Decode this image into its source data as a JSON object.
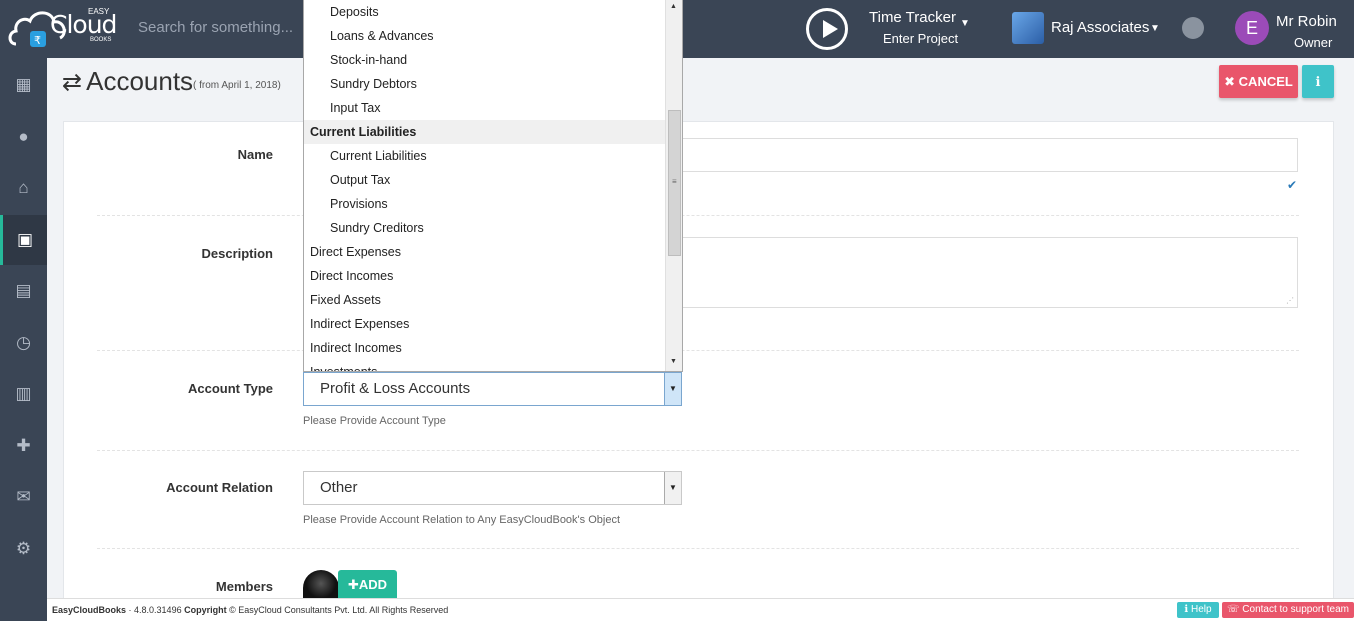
{
  "header": {
    "logo": {
      "easy": "EASY",
      "cloud": "Cloud",
      "books": "BOOKS"
    },
    "search_placeholder": "Search for something...",
    "time_tracker": {
      "title": "Time Tracker",
      "subtitle": "Enter Project"
    },
    "company": "Raj Associates",
    "user": {
      "initial": "E",
      "name": "Mr Robin",
      "role": "Owner"
    }
  },
  "sidebar": {
    "items": [
      {
        "icon": "dashboard-icon",
        "glyph": "▦"
      },
      {
        "icon": "user-icon",
        "glyph": "●"
      },
      {
        "icon": "bank-icon",
        "glyph": "⌂"
      },
      {
        "icon": "briefcase-icon",
        "glyph": "▣"
      },
      {
        "icon": "document-icon",
        "glyph": "▤"
      },
      {
        "icon": "clock-icon",
        "glyph": "◷"
      },
      {
        "icon": "newspaper-icon",
        "glyph": "▥"
      },
      {
        "icon": "plus-icon",
        "glyph": "✚"
      },
      {
        "icon": "envelope-icon",
        "glyph": "✉"
      },
      {
        "icon": "gear-icon",
        "glyph": "⚙"
      }
    ],
    "active_index": 3
  },
  "page": {
    "title": "Accounts",
    "subtitle": "( from April 1, 2018)",
    "cancel_label": "CANCEL",
    "info_glyph": "ℹ"
  },
  "form": {
    "name_label": "Name",
    "description_label": "Description",
    "account_type_label": "Account Type",
    "account_type_value": "Profit & Loss Accounts",
    "account_type_help": "Please Provide Account Type",
    "account_relation_label": "Account Relation",
    "account_relation_value": "Other",
    "account_relation_help": "Please Provide Account Relation to Any EasyCloudBook's Object",
    "members_label": "Members",
    "add_label": "ADD"
  },
  "dropdown": {
    "items": [
      {
        "text": "Deposits",
        "kind": "child"
      },
      {
        "text": "Loans & Advances",
        "kind": "child"
      },
      {
        "text": "Stock-in-hand",
        "kind": "child"
      },
      {
        "text": "Sundry Debtors",
        "kind": "child"
      },
      {
        "text": "Input Tax",
        "kind": "child"
      },
      {
        "text": "Current Liabilities",
        "kind": "group"
      },
      {
        "text": "Current Liabilities",
        "kind": "child"
      },
      {
        "text": "Output Tax",
        "kind": "child"
      },
      {
        "text": "Provisions",
        "kind": "child"
      },
      {
        "text": "Sundry Creditors",
        "kind": "child"
      },
      {
        "text": "Direct Expenses",
        "kind": "top"
      },
      {
        "text": "Direct Incomes",
        "kind": "top"
      },
      {
        "text": "Fixed Assets",
        "kind": "top"
      },
      {
        "text": "Indirect Expenses",
        "kind": "top"
      },
      {
        "text": "Indirect Incomes",
        "kind": "top"
      },
      {
        "text": "Investments",
        "kind": "top"
      }
    ]
  },
  "footer": {
    "brand": "EasyCloudBooks",
    "version": " · 4.8.0.31496 ",
    "copyright_label": "Copyright",
    "copyright_text": " © EasyCloud Consultants Pvt. Ltd. All Rights Reserved",
    "help_label": "Help",
    "support_label": "Contact to support team"
  },
  "colors": {
    "topbar": "#3a4555",
    "accent_green": "#26b99a",
    "cancel_red": "#e9566b",
    "info_teal": "#3fc3c9"
  }
}
